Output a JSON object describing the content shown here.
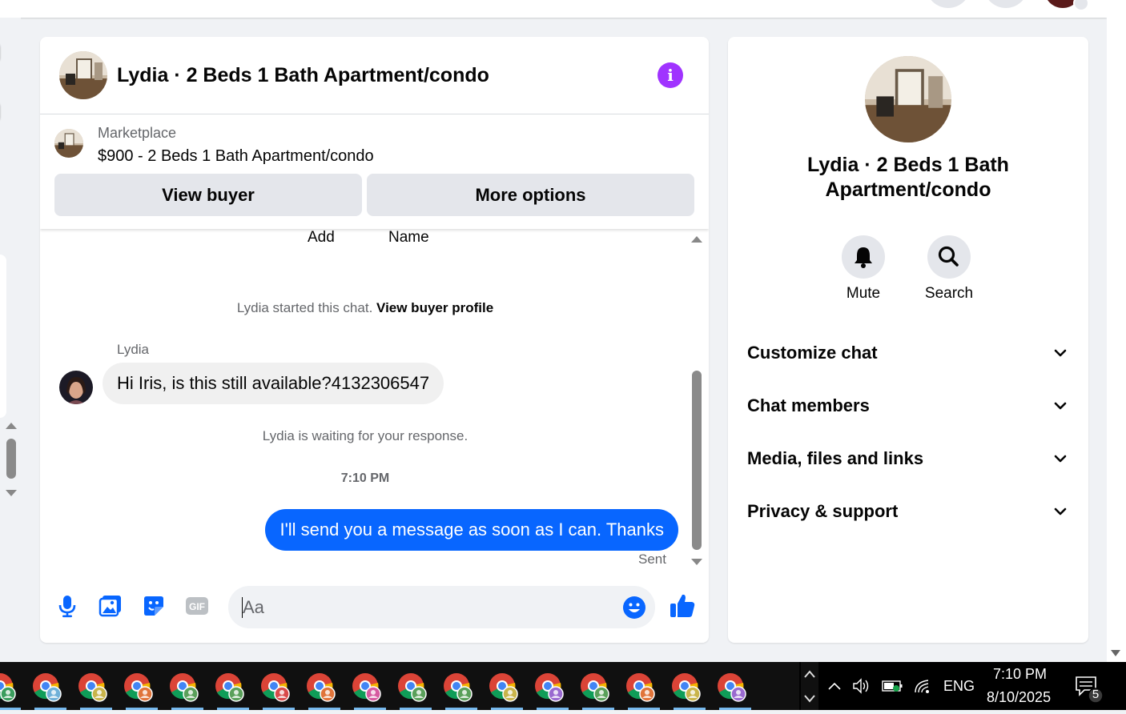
{
  "window": {
    "title": "Lydia · 2 Beds 1 Bath Apartment/condo"
  },
  "chat_header": {
    "title": "Lydia · 2 Beds 1 Bath Apartment/condo",
    "info_icon": "info-icon"
  },
  "marketplace": {
    "label": "Marketplace",
    "listing": "$900 - 2 Beds 1 Bath Apartment/condo",
    "view_buyer_label": "View buyer",
    "more_options_label": "More options"
  },
  "thread": {
    "add_label": "Add",
    "name_label": "Name",
    "started_text": "Lydia started this chat.",
    "view_profile_link": "View buyer profile",
    "sender_name": "Lydia",
    "incoming_message": "Hi Iris, is this still available?4132306547",
    "waiting_text": "Lydia is waiting for your response.",
    "timestamp": "7:10 PM",
    "outgoing_message": "I'll send you a message as soon as I can. Thanks",
    "sent_status": "Sent"
  },
  "composer": {
    "placeholder": "Aa",
    "icons": [
      "microphone-icon",
      "photo-icon",
      "sticker-icon",
      "gif-icon",
      "emoji-icon",
      "thumbs-up-icon"
    ],
    "gif_text": "GIF"
  },
  "info_panel": {
    "name": "Lydia · 2 Beds 1 Bath Apartment/condo",
    "mute_label": "Mute",
    "search_label": "Search",
    "sections": [
      "Customize chat",
      "Chat members",
      "Media, files and links",
      "Privacy & support"
    ]
  },
  "taskbar": {
    "app_icon": "chrome-profile-icon",
    "app_count": 17,
    "language": "ENG",
    "time": "7:10 PM",
    "date": "8/10/2025",
    "notification_count": "5"
  },
  "colors": {
    "accent_blue": "#0866ff",
    "info_purple": "#a033ff",
    "icon_blue": "#0866ff"
  }
}
